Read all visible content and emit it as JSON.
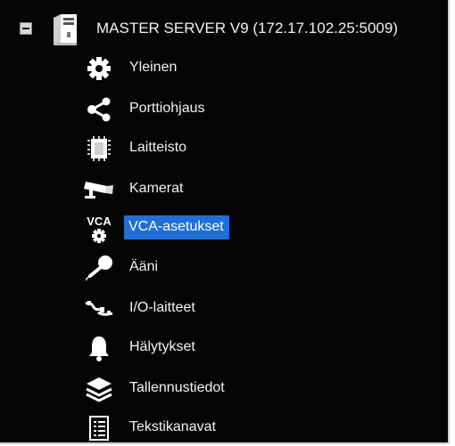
{
  "tree": {
    "root": {
      "label": "MASTER SERVER V9 (172.17.102.25:5009)",
      "expanded": true,
      "icon": "server-icon"
    },
    "items": [
      {
        "label": "Yleinen",
        "icon": "gear-icon"
      },
      {
        "label": "Porttiohjaus",
        "icon": "share-icon"
      },
      {
        "label": "Laitteisto",
        "icon": "chip-icon"
      },
      {
        "label": "Kamerat",
        "icon": "camera-icon"
      },
      {
        "label": "VCA-asetukset",
        "icon": "vca-icon",
        "icon_text": "VCA",
        "selected": true
      },
      {
        "label": "Ääni",
        "icon": "microphone-icon"
      },
      {
        "label": "I/O-laitteet",
        "icon": "io-icon"
      },
      {
        "label": "Hälytykset",
        "icon": "bell-icon"
      },
      {
        "label": "Tallennustiedot",
        "icon": "layers-icon"
      },
      {
        "label": "Tekstikanavat",
        "icon": "text-channel-icon"
      }
    ]
  },
  "colors": {
    "background": "#050505",
    "selection": "#1f6fd6",
    "text": "#f2f2f2"
  }
}
